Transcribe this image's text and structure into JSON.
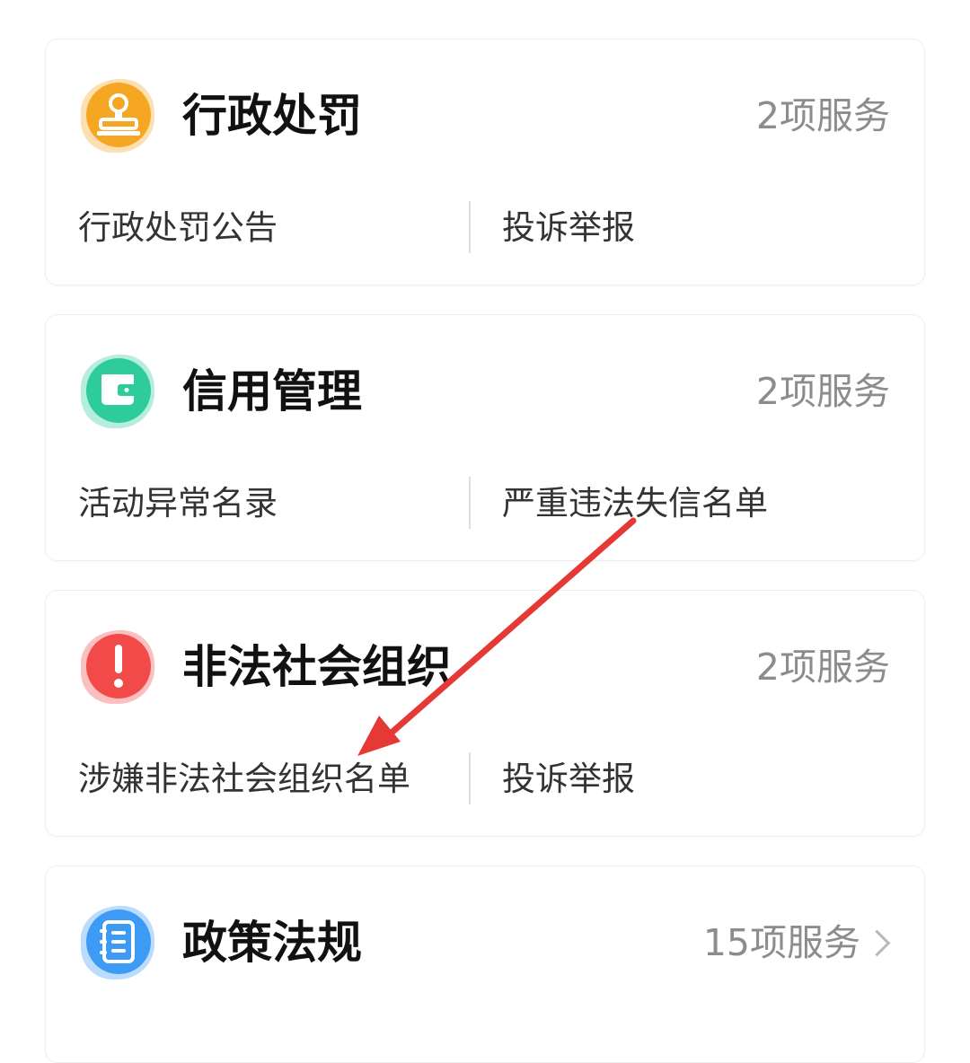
{
  "cards": [
    {
      "title": "行政处罚",
      "count": "2项服务",
      "icon": "stamp-icon",
      "color": "#F5A623",
      "links": [
        "行政处罚公告",
        "投诉举报"
      ]
    },
    {
      "title": "信用管理",
      "count": "2项服务",
      "icon": "wallet-icon",
      "color": "#2ECC9A",
      "links": [
        "活动异常名录",
        "严重违法失信名单"
      ]
    },
    {
      "title": "非法社会组织",
      "count": "2项服务",
      "icon": "exclamation-icon",
      "color": "#F24949",
      "links": [
        "涉嫌非法社会组织名单",
        "投诉举报"
      ]
    },
    {
      "title": "政策法规",
      "count": "15项服务",
      "icon": "notebook-icon",
      "color": "#3D9BF5",
      "links": []
    }
  ],
  "annotation": {
    "color": "#E53935"
  }
}
